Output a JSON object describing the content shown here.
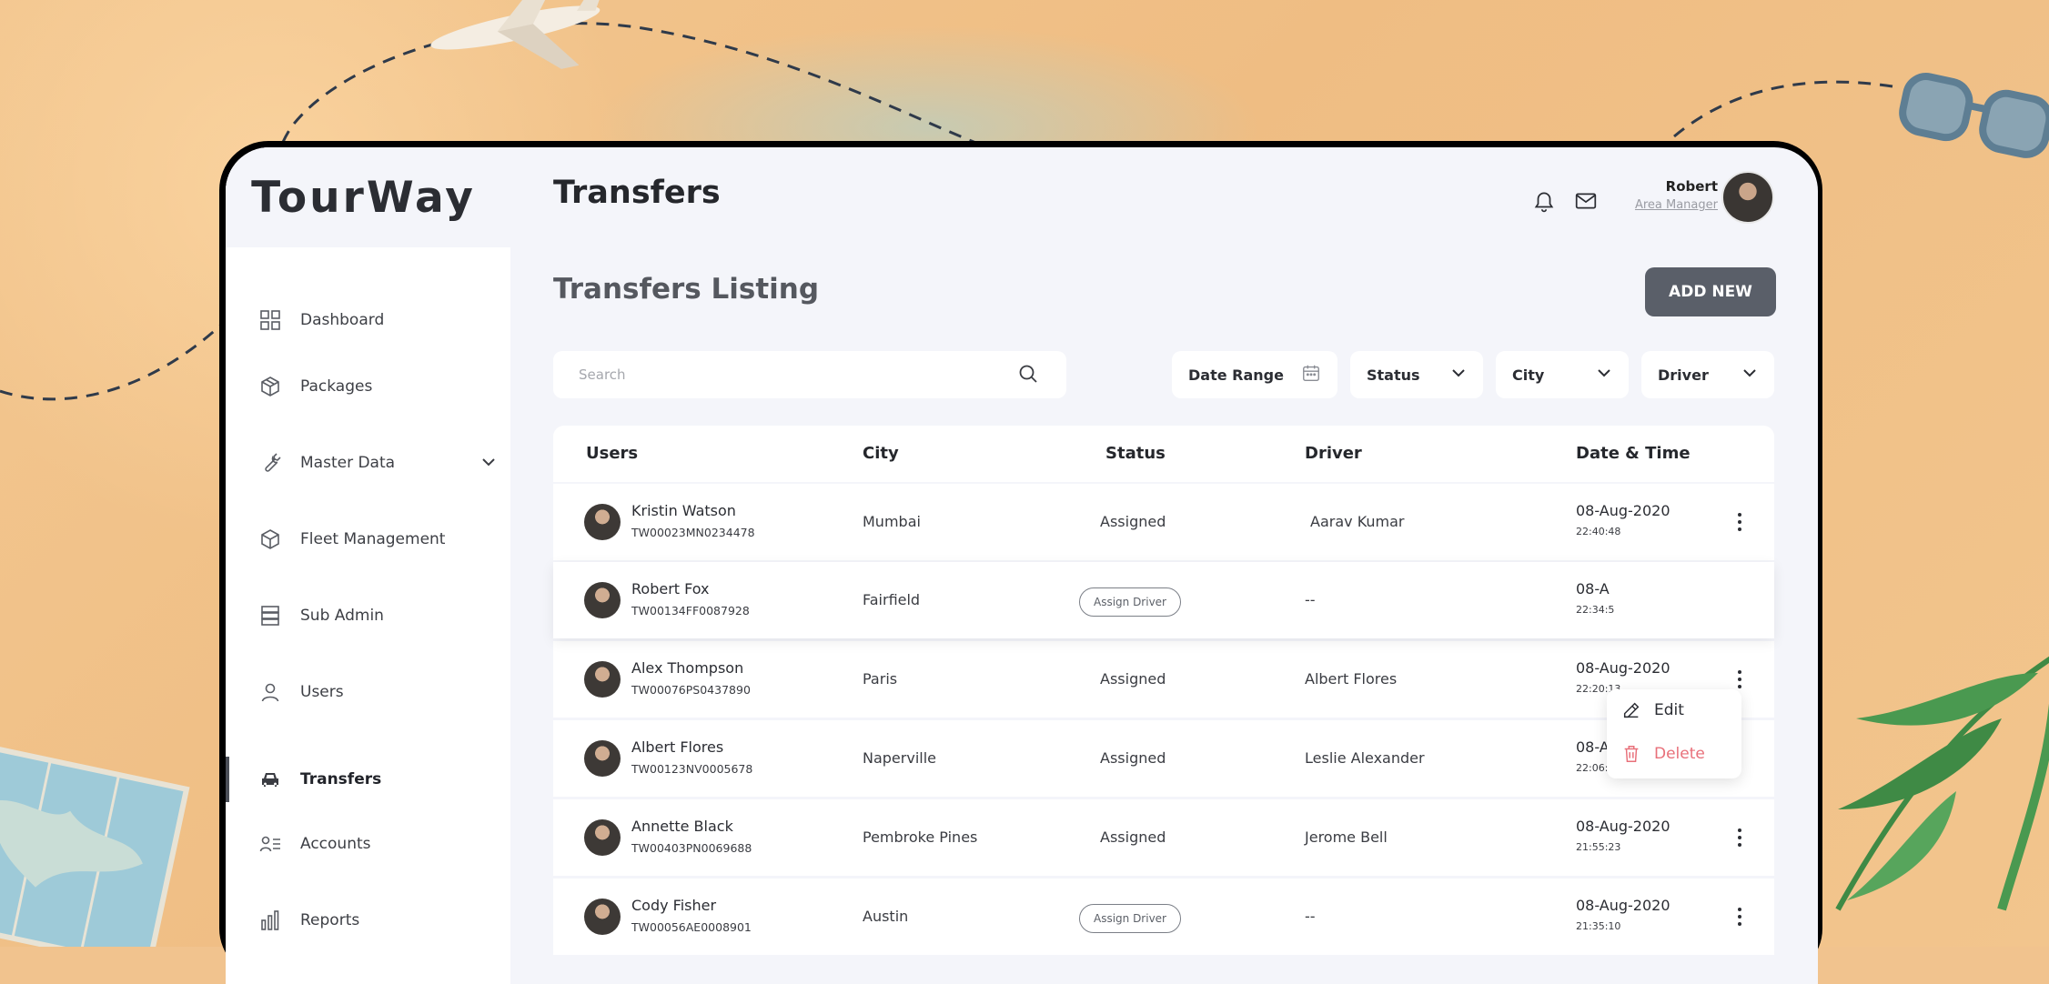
{
  "app": {
    "logo_text": "TourWay"
  },
  "sidebar": {
    "items": [
      {
        "label": "Dashboard",
        "icon": "grid-icon"
      },
      {
        "label": "Packages",
        "icon": "box-icon"
      },
      {
        "label": "Master Data",
        "icon": "wrench-icon"
      },
      {
        "label": "Fleet Management",
        "icon": "cube-icon"
      },
      {
        "label": "Sub Admin",
        "icon": "server-icon"
      },
      {
        "label": "Users",
        "icon": "user-icon"
      },
      {
        "label": "Transfers",
        "icon": "car-icon"
      },
      {
        "label": "Accounts",
        "icon": "list-user-icon"
      },
      {
        "label": "Reports",
        "icon": "bar-chart-icon"
      }
    ],
    "active": "Transfers"
  },
  "header": {
    "title": "Transfers",
    "user_name": "Robert",
    "user_role": "Area Manager"
  },
  "main": {
    "section_title": "Transfers Listing",
    "add_button": "ADD NEW",
    "search_placeholder": "Search",
    "filters": {
      "date_range": "Date Range",
      "status": "Status",
      "city": "City",
      "driver": "Driver"
    }
  },
  "table": {
    "columns": [
      "Users",
      "City",
      "Status",
      "Driver",
      "Date & Time"
    ],
    "rows": [
      {
        "name": "Kristin Watson",
        "id": "TW00023MN0234478",
        "city": "Mumbai",
        "status": "Assigned",
        "driver": "Aarav Kumar",
        "date": "08-Aug-2020",
        "time": "22:40:48"
      },
      {
        "name": "Robert Fox",
        "id": "TW00134FF0087928",
        "city": "Fairfield",
        "status": "Assign Driver",
        "driver": "--",
        "date": "08-A",
        "time": "22:34:5"
      },
      {
        "name": "Alex Thompson",
        "id": "TW00076PS0437890",
        "city": "Paris",
        "status": "Assigned",
        "driver": "Albert Flores",
        "date": "08-Aug-2020",
        "time": "22:20:13"
      },
      {
        "name": "Albert Flores",
        "id": "TW00123NV0005678",
        "city": "Naperville",
        "status": "Assigned",
        "driver": "Leslie Alexander",
        "date": "08-Aug-2020",
        "time": "22:06:30"
      },
      {
        "name": "Annette Black",
        "id": "TW00403PN0069688",
        "city": "Pembroke Pines",
        "status": "Assigned",
        "driver": "Jerome Bell",
        "date": "08-Aug-2020",
        "time": "21:55:23"
      },
      {
        "name": "Cody Fisher",
        "id": "TW00056AE0008901",
        "city": "Austin",
        "status": "Assign Driver",
        "driver": "--",
        "date": "08-Aug-2020",
        "time": "21:35:10"
      }
    ]
  },
  "row_menu": {
    "edit": "Edit",
    "delete": "Delete"
  },
  "colors": {
    "accent": "#5a5f69",
    "delete": "#e8707a",
    "background_sand": "#f1c38e"
  }
}
